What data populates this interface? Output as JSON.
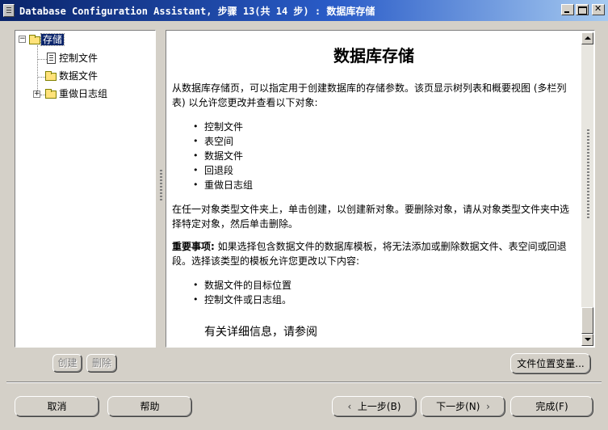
{
  "window": {
    "title": "Database Configuration Assistant, 步骤 13(共 14 步) : 数据库存储"
  },
  "tree": {
    "root": {
      "label": "存储",
      "expanded_symbol": "⊖"
    },
    "items": [
      {
        "label": "控制文件",
        "icon": "document-icon"
      },
      {
        "label": "数据文件",
        "icon": "folder-icon"
      },
      {
        "label": "重做日志组",
        "icon": "folder-icon",
        "expander": "+"
      }
    ]
  },
  "tree_buttons": {
    "create": "创建",
    "delete": "删除"
  },
  "content": {
    "title": "数据库存储",
    "p1": "从数据库存储页，可以指定用于创建数据库的存储参数。该页显示树列表和概要视图 (多栏列表) 以允许您更改并查看以下对象:",
    "list1": [
      "控制文件",
      "表空间",
      "数据文件",
      "回退段",
      "重做日志组"
    ],
    "p2": "在任一对象类型文件夹上，单击创建，以创建新对象。要删除对象，请从对象类型文件夹中选择特定对象，然后单击删除。",
    "p3_bold": "重要事项:",
    "p3": " 如果选择包含数据文件的数据库模板，将无法添加或删除数据文件、表空间或回退段。选择该类型的模板允许您更改以下内容:",
    "list2": [
      "数据文件的目标位置",
      "控制文件或日志组。"
    ],
    "more_info": "有关详细信息，请参阅"
  },
  "buttons": {
    "file_location": "文件位置变量...",
    "cancel": "取消",
    "help": "帮助",
    "back": "上一步(B)",
    "next": "下一步(N)",
    "finish": "完成(F)"
  }
}
